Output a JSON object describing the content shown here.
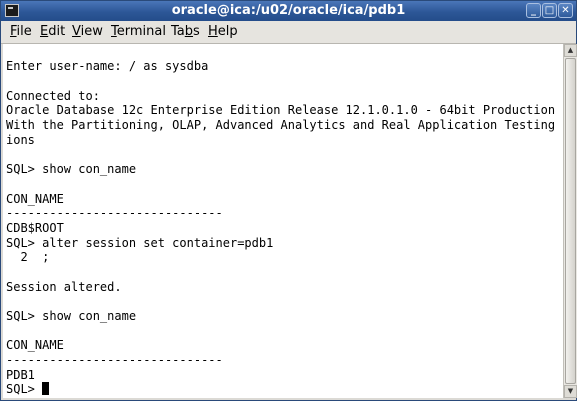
{
  "window": {
    "title": "oracle@ica:/u02/oracle/ica/pdb1",
    "minimize_glyph": "_",
    "maximize_glyph": "□",
    "close_glyph": "✕"
  },
  "menu": [
    {
      "label": "File",
      "underline": "F",
      "rest": "ile"
    },
    {
      "label": "Edit",
      "underline": "E",
      "rest": "dit"
    },
    {
      "label": "View",
      "underline": "V",
      "rest": "iew"
    },
    {
      "label": "Terminal",
      "underline": "T",
      "rest": "erminal"
    },
    {
      "label": "Tabs",
      "pre": "Ta",
      "underline": "b",
      "rest": "s"
    },
    {
      "label": "Help",
      "underline": "H",
      "rest": "elp"
    }
  ],
  "terminal": {
    "lines": [
      "",
      "Enter user-name: / as sysdba",
      "",
      "Connected to:",
      "Oracle Database 12c Enterprise Edition Release 12.1.0.1.0 - 64bit Production",
      "With the Partitioning, OLAP, Advanced Analytics and Real Application Testing opt",
      "ions",
      "",
      "SQL> show con_name",
      "",
      "CON_NAME",
      "------------------------------",
      "CDB$ROOT",
      "SQL> alter session set container=pdb1",
      "  2  ;",
      "",
      "Session altered.",
      "",
      "SQL> show con_name",
      "",
      "CON_NAME",
      "------------------------------",
      "PDB1"
    ],
    "prompt": "SQL> "
  },
  "colors": {
    "titlebar": "#2d5797",
    "terminal_bg": "#ffffff",
    "terminal_fg": "#000000"
  }
}
